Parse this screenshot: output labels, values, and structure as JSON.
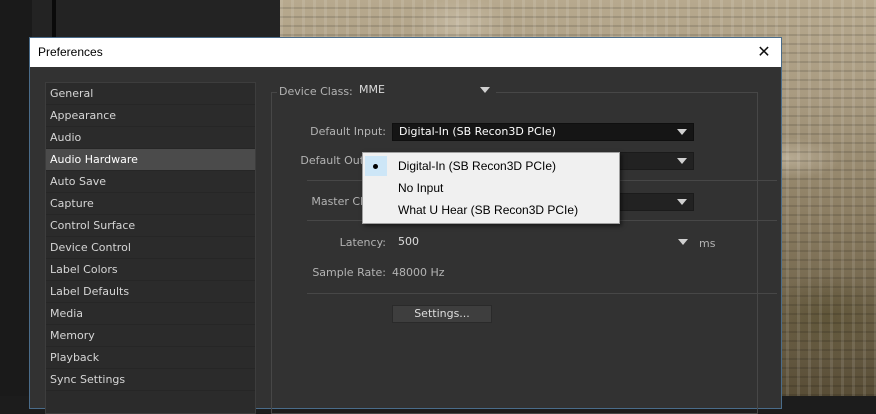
{
  "window": {
    "title": "Preferences",
    "close_glyph": "✕"
  },
  "sidebar": {
    "items": [
      {
        "label": "General"
      },
      {
        "label": "Appearance"
      },
      {
        "label": "Audio"
      },
      {
        "label": "Audio Hardware",
        "selected": true
      },
      {
        "label": "Auto Save"
      },
      {
        "label": "Capture"
      },
      {
        "label": "Control Surface"
      },
      {
        "label": "Device Control"
      },
      {
        "label": "Label Colors"
      },
      {
        "label": "Label Defaults"
      },
      {
        "label": "Media"
      },
      {
        "label": "Memory"
      },
      {
        "label": "Playback"
      },
      {
        "label": "Sync Settings"
      }
    ]
  },
  "audio_hardware": {
    "device_class_label": "Device Class:",
    "device_class_value": "MME",
    "default_input_label": "Default Input:",
    "default_input_value": "Digital-In (SB Recon3D PCIe)",
    "default_output_label": "Default Output:",
    "master_clock_label": "Master Clock:",
    "latency_label": "Latency:",
    "latency_value": "500",
    "latency_unit": "ms",
    "sample_rate_label": "Sample Rate:",
    "sample_rate_value": "48000 Hz",
    "settings_button": "Settings..."
  },
  "input_menu": {
    "options": [
      {
        "label": "Digital-In (SB Recon3D PCIe)",
        "selected": true
      },
      {
        "label": "No Input",
        "selected": false
      },
      {
        "label": "What U Hear (SB Recon3D PCIe)",
        "selected": false
      }
    ]
  },
  "icons": {
    "close": "close-icon",
    "dropdown": "chevron-down-icon",
    "selected_marker": "bullet-icon"
  },
  "colors": {
    "dialog_background": "#323232",
    "selection_highlight": "#cde6f7",
    "sidebar_selected": "#4b4b4b"
  }
}
